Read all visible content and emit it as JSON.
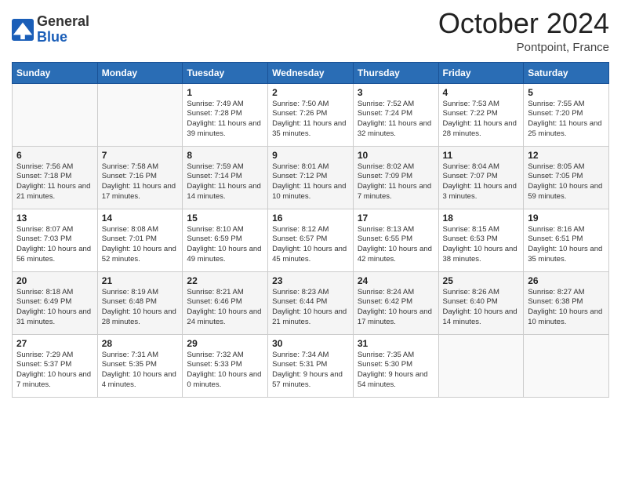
{
  "header": {
    "logo_line1": "General",
    "logo_line2": "Blue",
    "title": "October 2024",
    "subtitle": "Pontpoint, France"
  },
  "weekdays": [
    "Sunday",
    "Monday",
    "Tuesday",
    "Wednesday",
    "Thursday",
    "Friday",
    "Saturday"
  ],
  "weeks": [
    [
      {
        "day": "",
        "info": ""
      },
      {
        "day": "",
        "info": ""
      },
      {
        "day": "1",
        "info": "Sunrise: 7:49 AM\nSunset: 7:28 PM\nDaylight: 11 hours and 39 minutes."
      },
      {
        "day": "2",
        "info": "Sunrise: 7:50 AM\nSunset: 7:26 PM\nDaylight: 11 hours and 35 minutes."
      },
      {
        "day": "3",
        "info": "Sunrise: 7:52 AM\nSunset: 7:24 PM\nDaylight: 11 hours and 32 minutes."
      },
      {
        "day": "4",
        "info": "Sunrise: 7:53 AM\nSunset: 7:22 PM\nDaylight: 11 hours and 28 minutes."
      },
      {
        "day": "5",
        "info": "Sunrise: 7:55 AM\nSunset: 7:20 PM\nDaylight: 11 hours and 25 minutes."
      }
    ],
    [
      {
        "day": "6",
        "info": "Sunrise: 7:56 AM\nSunset: 7:18 PM\nDaylight: 11 hours and 21 minutes."
      },
      {
        "day": "7",
        "info": "Sunrise: 7:58 AM\nSunset: 7:16 PM\nDaylight: 11 hours and 17 minutes."
      },
      {
        "day": "8",
        "info": "Sunrise: 7:59 AM\nSunset: 7:14 PM\nDaylight: 11 hours and 14 minutes."
      },
      {
        "day": "9",
        "info": "Sunrise: 8:01 AM\nSunset: 7:12 PM\nDaylight: 11 hours and 10 minutes."
      },
      {
        "day": "10",
        "info": "Sunrise: 8:02 AM\nSunset: 7:09 PM\nDaylight: 11 hours and 7 minutes."
      },
      {
        "day": "11",
        "info": "Sunrise: 8:04 AM\nSunset: 7:07 PM\nDaylight: 11 hours and 3 minutes."
      },
      {
        "day": "12",
        "info": "Sunrise: 8:05 AM\nSunset: 7:05 PM\nDaylight: 10 hours and 59 minutes."
      }
    ],
    [
      {
        "day": "13",
        "info": "Sunrise: 8:07 AM\nSunset: 7:03 PM\nDaylight: 10 hours and 56 minutes."
      },
      {
        "day": "14",
        "info": "Sunrise: 8:08 AM\nSunset: 7:01 PM\nDaylight: 10 hours and 52 minutes."
      },
      {
        "day": "15",
        "info": "Sunrise: 8:10 AM\nSunset: 6:59 PM\nDaylight: 10 hours and 49 minutes."
      },
      {
        "day": "16",
        "info": "Sunrise: 8:12 AM\nSunset: 6:57 PM\nDaylight: 10 hours and 45 minutes."
      },
      {
        "day": "17",
        "info": "Sunrise: 8:13 AM\nSunset: 6:55 PM\nDaylight: 10 hours and 42 minutes."
      },
      {
        "day": "18",
        "info": "Sunrise: 8:15 AM\nSunset: 6:53 PM\nDaylight: 10 hours and 38 minutes."
      },
      {
        "day": "19",
        "info": "Sunrise: 8:16 AM\nSunset: 6:51 PM\nDaylight: 10 hours and 35 minutes."
      }
    ],
    [
      {
        "day": "20",
        "info": "Sunrise: 8:18 AM\nSunset: 6:49 PM\nDaylight: 10 hours and 31 minutes."
      },
      {
        "day": "21",
        "info": "Sunrise: 8:19 AM\nSunset: 6:48 PM\nDaylight: 10 hours and 28 minutes."
      },
      {
        "day": "22",
        "info": "Sunrise: 8:21 AM\nSunset: 6:46 PM\nDaylight: 10 hours and 24 minutes."
      },
      {
        "day": "23",
        "info": "Sunrise: 8:23 AM\nSunset: 6:44 PM\nDaylight: 10 hours and 21 minutes."
      },
      {
        "day": "24",
        "info": "Sunrise: 8:24 AM\nSunset: 6:42 PM\nDaylight: 10 hours and 17 minutes."
      },
      {
        "day": "25",
        "info": "Sunrise: 8:26 AM\nSunset: 6:40 PM\nDaylight: 10 hours and 14 minutes."
      },
      {
        "day": "26",
        "info": "Sunrise: 8:27 AM\nSunset: 6:38 PM\nDaylight: 10 hours and 10 minutes."
      }
    ],
    [
      {
        "day": "27",
        "info": "Sunrise: 7:29 AM\nSunset: 5:37 PM\nDaylight: 10 hours and 7 minutes."
      },
      {
        "day": "28",
        "info": "Sunrise: 7:31 AM\nSunset: 5:35 PM\nDaylight: 10 hours and 4 minutes."
      },
      {
        "day": "29",
        "info": "Sunrise: 7:32 AM\nSunset: 5:33 PM\nDaylight: 10 hours and 0 minutes."
      },
      {
        "day": "30",
        "info": "Sunrise: 7:34 AM\nSunset: 5:31 PM\nDaylight: 9 hours and 57 minutes."
      },
      {
        "day": "31",
        "info": "Sunrise: 7:35 AM\nSunset: 5:30 PM\nDaylight: 9 hours and 54 minutes."
      },
      {
        "day": "",
        "info": ""
      },
      {
        "day": "",
        "info": ""
      }
    ]
  ]
}
